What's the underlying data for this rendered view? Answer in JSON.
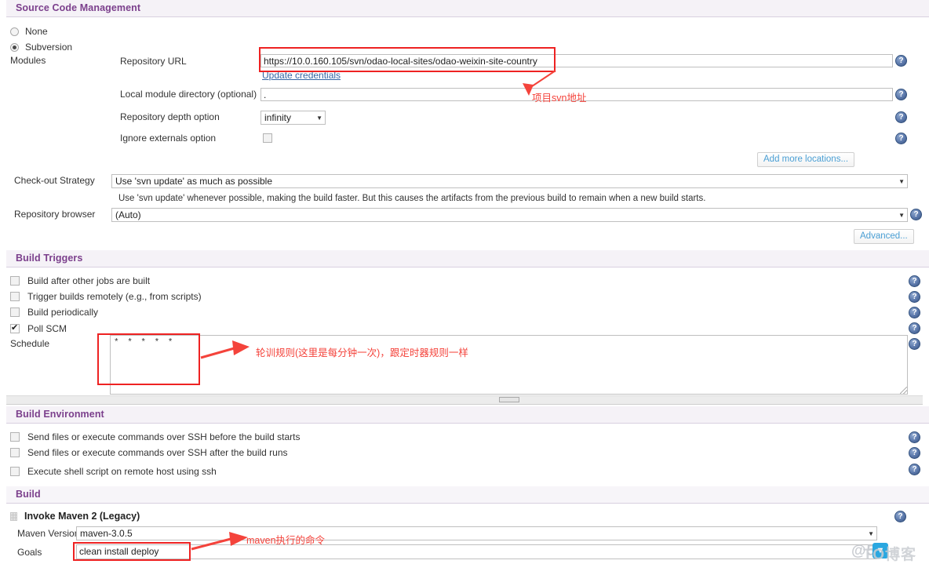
{
  "sections": {
    "scm": {
      "title": "Source Code Management",
      "radios": [
        {
          "label": "None",
          "selected": false
        },
        {
          "label": "Subversion",
          "selected": true
        }
      ],
      "modules_label": "Modules",
      "fields": {
        "repository_url": {
          "label": "Repository URL",
          "value": "https://10.0.160.105/svn/odao-local-sites/odao-weixin-site-country"
        },
        "update_credentials_link": "Update credentials",
        "local_module_directory": {
          "label": "Local module directory (optional)",
          "value": "."
        },
        "repository_depth": {
          "label": "Repository depth option",
          "value": "infinity"
        },
        "ignore_externals": {
          "label": "Ignore externals option",
          "checked": false
        }
      },
      "add_more_locations_button": "Add more locations...",
      "checkout_strategy": {
        "label": "Check-out Strategy",
        "value": "Use 'svn update' as much as possible",
        "description": "Use 'svn update' whenever possible, making the build faster. But this causes the artifacts from the previous build to remain when a new build starts."
      },
      "repository_browser": {
        "label": "Repository browser",
        "value": "(Auto)"
      },
      "advanced_button": "Advanced..."
    },
    "build_triggers": {
      "title": "Build Triggers",
      "checkboxes": [
        {
          "label": "Build after other jobs are built",
          "checked": false
        },
        {
          "label": "Trigger builds remotely (e.g., from scripts)",
          "checked": false
        },
        {
          "label": "Build periodically",
          "checked": false
        },
        {
          "label": "Poll SCM",
          "checked": true
        }
      ],
      "schedule": {
        "label": "Schedule",
        "value": "* * * * *"
      }
    },
    "build_environment": {
      "title": "Build Environment",
      "checkboxes": [
        {
          "label": "Send files or execute commands over SSH before the build starts",
          "checked": false
        },
        {
          "label": "Send files or execute commands over SSH after the build runs",
          "checked": false
        },
        {
          "label": "Execute shell script on remote host using ssh",
          "checked": false
        }
      ]
    },
    "build": {
      "title": "Build",
      "step_title": "Invoke Maven 2 (Legacy)",
      "maven_version": {
        "label": "Maven Version",
        "value": "maven-3.0.5"
      },
      "goals": {
        "label": "Goals",
        "value": "clean install deploy"
      }
    }
  },
  "annotations": [
    {
      "id": "svn-url",
      "text": "项目svn地址"
    },
    {
      "id": "poll-schedule",
      "text": "轮训规则(这里是每分钟一次)，跟定时器规则一样"
    },
    {
      "id": "maven-goals",
      "text": "maven执行的命令"
    }
  ],
  "watermark": {
    "text_before": "@51",
    "text_after": "TO博客",
    "badge_glyph": "▼"
  },
  "icons": {
    "help": "?",
    "dropdown_arrow": "▼"
  },
  "colors": {
    "section_header": "#7b3f8c",
    "annotation_red": "#f4433b",
    "link_blue": "#3465a4",
    "button_blue": "#4a9fd4"
  }
}
